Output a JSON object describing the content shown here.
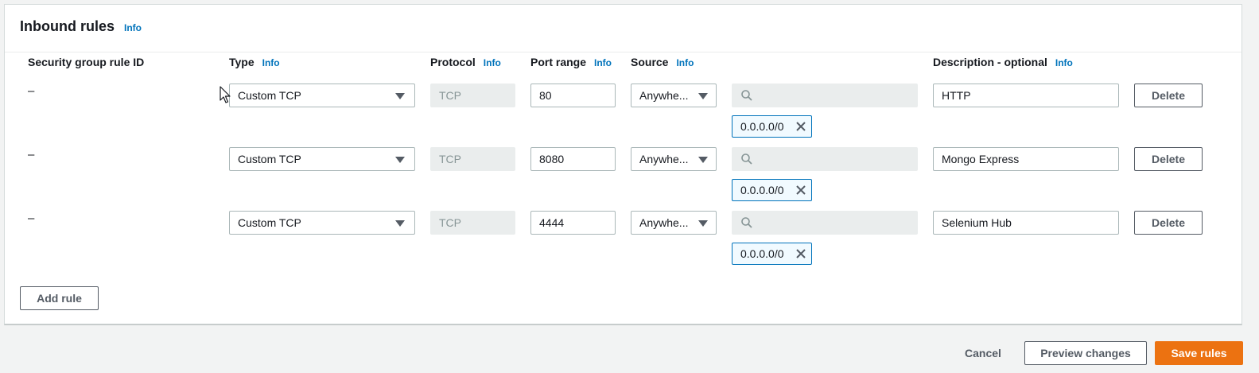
{
  "panel": {
    "title": "Inbound rules",
    "info": "Info"
  },
  "columns": {
    "rule_id": "Security group rule ID",
    "type": "Type",
    "protocol": "Protocol",
    "port_range": "Port range",
    "source": "Source",
    "description": "Description - optional",
    "info": "Info"
  },
  "rules": [
    {
      "rule_id": "–",
      "type": "Custom TCP",
      "protocol": "TCP",
      "port": "80",
      "source": "Anywhe...",
      "cidr": "0.0.0.0/0",
      "description": "HTTP",
      "delete": "Delete"
    },
    {
      "rule_id": "–",
      "type": "Custom TCP",
      "protocol": "TCP",
      "port": "8080",
      "source": "Anywhe...",
      "cidr": "0.0.0.0/0",
      "description": "Mongo Express",
      "delete": "Delete"
    },
    {
      "rule_id": "–",
      "type": "Custom TCP",
      "protocol": "TCP",
      "port": "4444",
      "source": "Anywhe...",
      "cidr": "0.0.0.0/0",
      "description": "Selenium Hub",
      "delete": "Delete"
    }
  ],
  "add_rule": "Add rule",
  "footer": {
    "cancel": "Cancel",
    "preview": "Preview changes",
    "save": "Save rules"
  },
  "icons": {
    "search": "search-icon",
    "remove": "close-icon",
    "dropdown": "caret-down-icon",
    "cursor": "mouse-pointer-icon"
  },
  "colors": {
    "primary": "#ec7211",
    "link": "#0073bb"
  }
}
